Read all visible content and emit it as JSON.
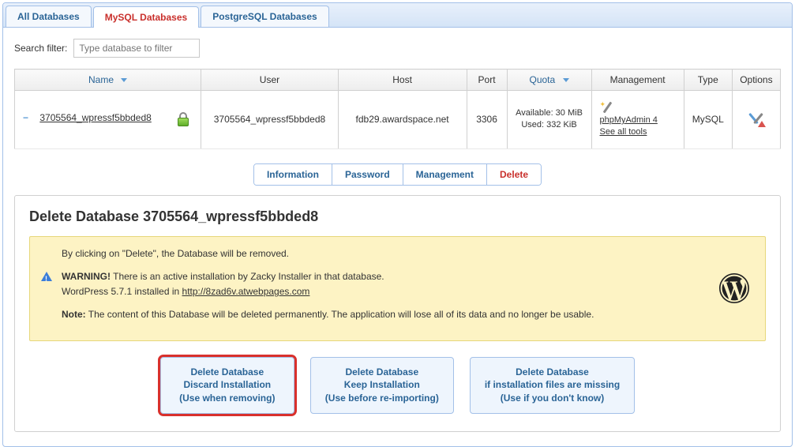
{
  "tabs": [
    {
      "label": "All Databases"
    },
    {
      "label": "MySQL Databases"
    },
    {
      "label": "PostgreSQL Databases"
    }
  ],
  "active_tab": 1,
  "search": {
    "label": "Search filter:",
    "placeholder": "Type database to filter"
  },
  "grid": {
    "headers": {
      "name": "Name",
      "user": "User",
      "host": "Host",
      "port": "Port",
      "quota": "Quota",
      "management": "Management",
      "type": "Type",
      "options": "Options"
    },
    "row": {
      "name": "3705564_wpressf5bbded8",
      "user": "3705564_wpressf5bbded8",
      "host": "fdb29.awardspace.net",
      "port": "3306",
      "quota_available": "Available: 30 MiB",
      "quota_used": "Used: 332 KiB",
      "mgmt_tool": "phpMyAdmin 4",
      "mgmt_all": "See all tools",
      "type": "MySQL"
    }
  },
  "subtabs": [
    {
      "label": "Information"
    },
    {
      "label": "Password"
    },
    {
      "label": "Management"
    },
    {
      "label": "Delete"
    }
  ],
  "active_subtab": 3,
  "detail": {
    "title": "Delete Database 3705564_wpressf5bbded8",
    "line1": "By clicking on \"Delete\", the Database will be removed.",
    "warn_label": "WARNING!",
    "warn_text": " There is an active installation by Zacky Installer in that database.",
    "install_prefix": "WordPress 5.7.1 installed in ",
    "install_url": "http://8zad6v.atwebpages.com",
    "note_label": "Note:",
    "note_text": " The content of this Database will be deleted permanently. The application will lose all of its data and no longer be usable."
  },
  "actions": [
    {
      "line1": "Delete Database",
      "line2": "Discard Installation",
      "line3": "(Use when removing)"
    },
    {
      "line1": "Delete Database",
      "line2": "Keep Installation",
      "line3": "(Use before re-importing)"
    },
    {
      "line1": "Delete Database",
      "line2": "if installation files are missing",
      "line3": "(Use if you don't know)"
    }
  ]
}
